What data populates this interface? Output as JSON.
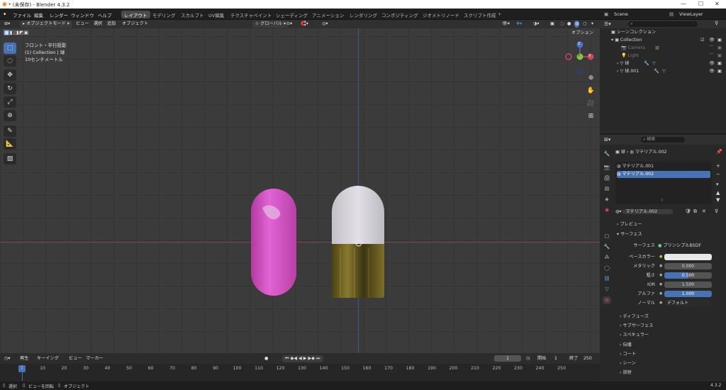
{
  "window": {
    "title": "* (未保存) - Blender 4.3.2",
    "min": "—",
    "max": "☐",
    "close": "✕"
  },
  "menu": {
    "items": [
      "ファイル",
      "編集",
      "レンダー",
      "ウィンドウ",
      "ヘルプ"
    ]
  },
  "workspaces": [
    "レイアウト",
    "モデリング",
    "スカルプト",
    "UV編集",
    "テクスチャペイント",
    "シェーディング",
    "アニメーション",
    "レンダリング",
    "コンポジティング",
    "ジオメトリノード",
    "スクリプト作成"
  ],
  "scene": {
    "label": "Scene",
    "viewlayer": "ViewLayer"
  },
  "viewport_header": {
    "mode": "オブジェクトモード",
    "menus": [
      "ビュー",
      "選択",
      "追加",
      "オブジェクト"
    ],
    "orientation": "グローバル",
    "options": "オプション"
  },
  "overlay_text": {
    "view": "フロント・平行投影",
    "collection": "(1) Collection | 球",
    "scale": "10センチメートル"
  },
  "gizmo": {
    "z": "Z",
    "y": "Y",
    "x": "X"
  },
  "objects": {
    "pink_color": "#d955c8",
    "white_color": "#d8d6dc",
    "gold_color": "#6a5e22"
  },
  "outliner": {
    "search": "",
    "title": "シーンコレクション",
    "rows": [
      {
        "name": "Collection",
        "dim": false
      },
      {
        "name": "Camera",
        "dim": true
      },
      {
        "name": "Light",
        "dim": true
      },
      {
        "name": "球",
        "dim": false
      },
      {
        "name": "球.001",
        "dim": false
      }
    ]
  },
  "properties": {
    "search_placeholder": "検索",
    "breadcrumb_obj": "球",
    "breadcrumb_mat": "マテリアル.002",
    "slots": [
      "マテリアル.001",
      "マテリアル.002"
    ],
    "material_name": "マテリアル.002",
    "sections": {
      "preview": "プレビュー",
      "surface": "サーフェス"
    },
    "surface_label": "サーフェス",
    "surface_value": "プリンシプルBSDF",
    "params": [
      {
        "label": "ベースカラー",
        "value": "",
        "type": "color"
      },
      {
        "label": "メタリック",
        "value": "0.000",
        "type": "plain"
      },
      {
        "label": "粗さ",
        "value": "0.500",
        "type": "blue_half"
      },
      {
        "label": "IOR",
        "value": "1.500",
        "type": "plain"
      },
      {
        "label": "アルファ",
        "value": "1.000",
        "type": "blue"
      },
      {
        "label": "ノーマル",
        "value": "デフォルト",
        "type": "text"
      }
    ],
    "subpanels": [
      "ディフューズ",
      "サブサーフェス",
      "スペキュラー",
      "伝播",
      "コート",
      "シーン",
      "放射"
    ]
  },
  "timeline": {
    "menus": [
      "再生",
      "キーイング",
      "ビュー",
      "マーカー"
    ],
    "current": "1",
    "start_label": "開始",
    "start": "1",
    "end_label": "終了",
    "end": "250",
    "ticks": [
      "1",
      "10",
      "20",
      "30",
      "40",
      "50",
      "60",
      "70",
      "80",
      "90",
      "100",
      "110",
      "120",
      "130",
      "140",
      "150",
      "160",
      "170",
      "180",
      "190",
      "200",
      "210",
      "220",
      "230",
      "240",
      "250"
    ]
  },
  "status": {
    "select": "選択",
    "rotate": "ビューを回転",
    "object": "オブジェクト",
    "version": "4.3.2"
  }
}
